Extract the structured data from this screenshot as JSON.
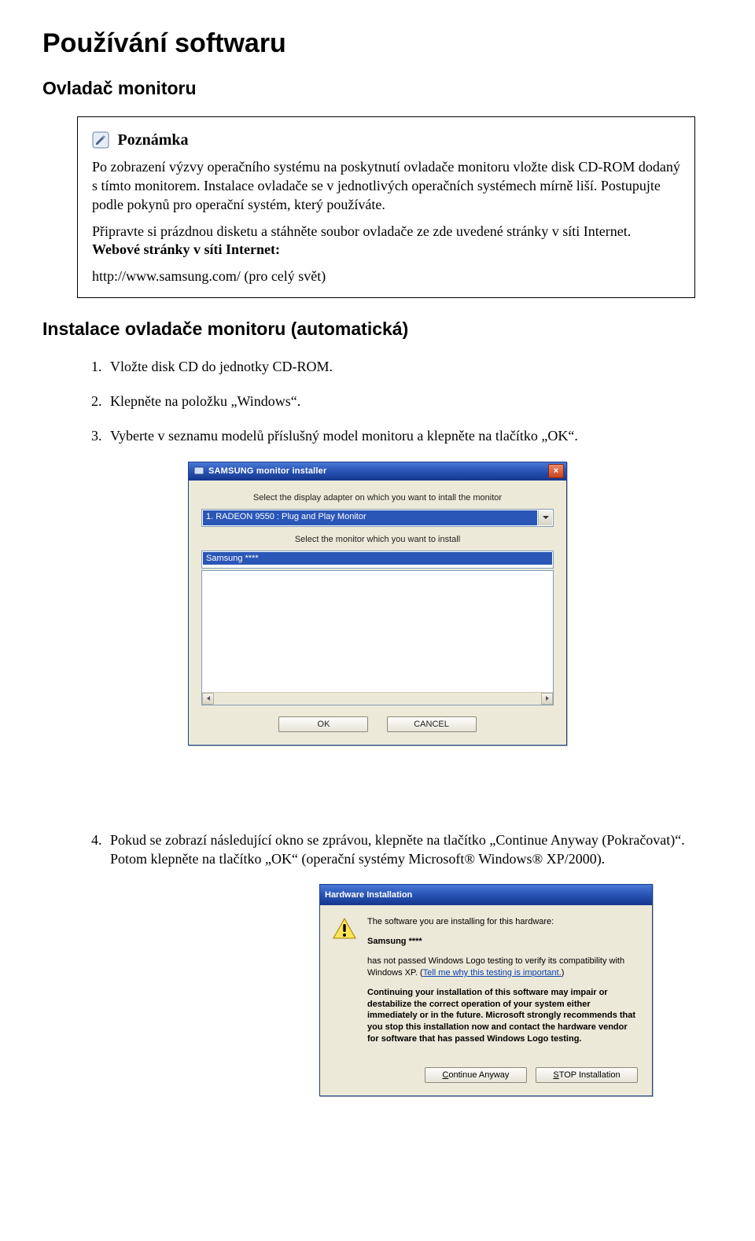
{
  "heading": "Používání softwaru",
  "subheading": "Ovladač monitoru",
  "note": {
    "label": "Poznámka",
    "p1": "Po zobrazení výzvy operačního systému na poskytnutí ovladače monitoru vložte disk CD-ROM dodaný s tímto monitorem. Instalace ovladače se v jednotlivých operačních systémech mírně liší. Postupujte podle pokynů pro operační systém, který používáte.",
    "p2a": "Připravte si prázdnou disketu a stáhněte soubor ovladače ze zde uvedené stránky v síti Internet.",
    "p2b": "Webové stránky v síti Internet:",
    "url": "http://www.samsung.com/ (pro celý svět)"
  },
  "section_title": "Instalace ovladače monitoru (automatická)",
  "steps": [
    "Vložte disk CD do jednotky CD-ROM.",
    "Klepněte na položku „Windows“.",
    "Vyberte v seznamu modelů příslušný model monitoru a klepněte na tlačítko „OK“.",
    "Pokud se zobrazí následující okno se zprávou, klepněte na tlačítko „Continue Anyway (Pokračovat)“. Potom klepněte na tlačítko „OK“ (operační systémy Microsoft® Windows® XP/2000)."
  ],
  "dlg1": {
    "title": "SAMSUNG monitor installer",
    "label_adapter": "Select the display adapter on which you want to intall the monitor",
    "adapter_selected": "1. RADEON 9550 : Plug and Play Monitor",
    "label_monitor": "Select the monitor which you want to install",
    "monitor_selected": "Samsung ****",
    "btn_ok": "OK",
    "btn_cancel": "CANCEL"
  },
  "dlg2": {
    "title": "Hardware Installation",
    "line1": "The software you are installing for this hardware:",
    "hw": "Samsung ****",
    "line2a": "has not passed Windows Logo testing to verify its compatibility with Windows XP. (",
    "link": "Tell me why this testing is important.",
    "line2b": ")",
    "bold": "Continuing your installation of this software may impair or destabilize the correct operation of your system either immediately or in the future. Microsoft strongly recommends that you stop this installation now and contact the hardware vendor for software that has passed Windows Logo testing.",
    "btn_continue": "Continue Anyway",
    "btn_stop": "STOP Installation",
    "btn_continue_ul": "C",
    "btn_stop_ul": "S"
  }
}
